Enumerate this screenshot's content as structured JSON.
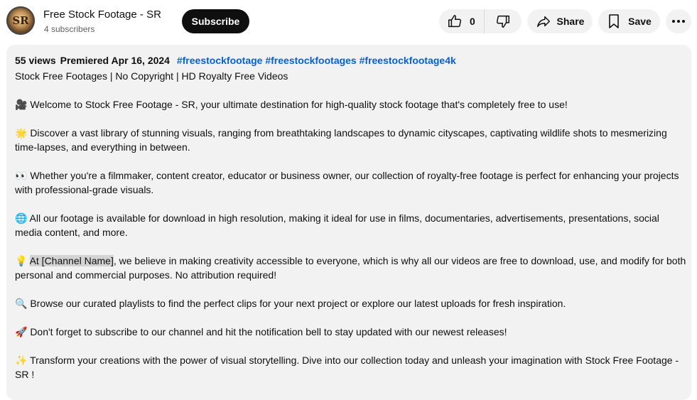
{
  "channel": {
    "name": "Free Stock Footage - SR",
    "subscribers": "4 subscribers",
    "avatar_text": "SR"
  },
  "actions": {
    "subscribe_label": "Subscribe",
    "like_count": "0",
    "share_label": "Share",
    "save_label": "Save"
  },
  "icons": [
    "thumbs-up-icon",
    "thumbs-down-icon",
    "share-arrow-icon",
    "bookmark-icon",
    "more-horizontal-icon"
  ],
  "description": {
    "views": "55 views",
    "premiered": "Premiered Apr 16, 2024",
    "hashtags": [
      "#freestockfootage",
      "#freestockfootages",
      "#freestockfootage4k"
    ],
    "subtitle": "Stock Free Footages | No Copyright | HD Royalty Free Videos",
    "paragraphs": {
      "p1": "🎥 Welcome to Stock Free Footage - SR,  your ultimate destination for high-quality stock footage that's completely free to use!",
      "p2": "🌟 Discover a vast library of stunning visuals, ranging from breathtaking landscapes to dynamic cityscapes, captivating wildlife shots to mesmerizing time-lapses, and everything in between.",
      "p3": "👀 Whether you're a filmmaker, content creator, educator or business owner, our collection of royalty-free footage is perfect for enhancing your projects with professional-grade visuals.",
      "p4": "🌐 All our footage is available for download in high resolution, making it ideal for use in films, documentaries, advertisements, presentations, social media content, and more.",
      "p5_emoji": "💡 ",
      "p5_highlight": "At [Channel Name]",
      "p5_rest": ", we believe in making creativity accessible to everyone, which is why all our videos are free to download, use, and modify for both personal and commercial purposes. No attribution required!",
      "p6": "🔍 Browse our curated playlists to find the perfect clips for your next project or explore our latest uploads for fresh inspiration.",
      "p7": "🚀 Don't forget to subscribe to our channel and hit the notification bell to stay updated with our newest releases!",
      "p8": "✨ Transform your creations with the power of visual storytelling. Dive into our collection today and unleash your imagination with Stock Free Footage - SR !"
    }
  },
  "colors": {
    "hashtag": "#065fd4",
    "panel_bg": "#f2f2f2",
    "subscribe_bg": "#0f0f0f",
    "highlight": "#d3d3d3"
  }
}
